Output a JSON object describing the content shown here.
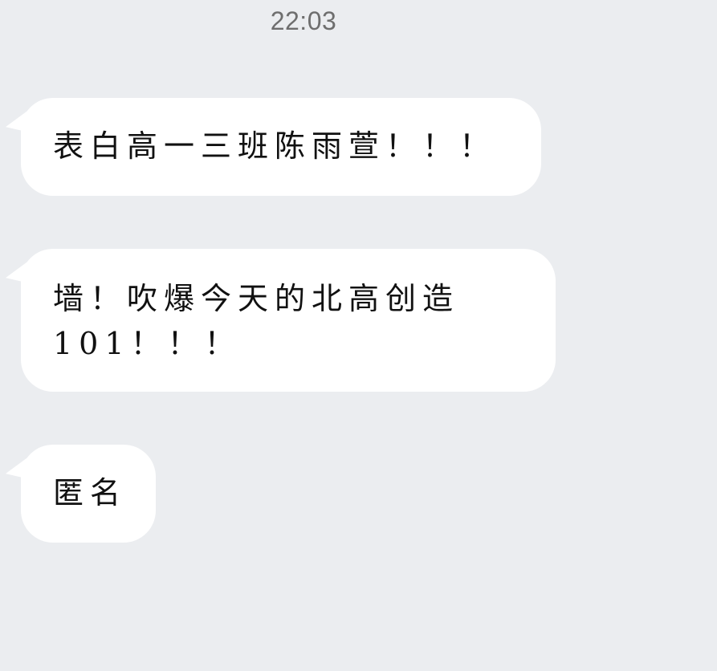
{
  "header": {
    "timestamp": "22:03"
  },
  "messages": [
    {
      "text": "表白高一三班陈雨萱！！！"
    },
    {
      "text": "墙！吹爆今天的北高创造\n101！！！"
    },
    {
      "text": "匿名"
    }
  ],
  "colors": {
    "background": "#EBEDF0",
    "bubble": "#FFFFFF",
    "text": "#111111",
    "timestamp": "#6E6E6E"
  }
}
